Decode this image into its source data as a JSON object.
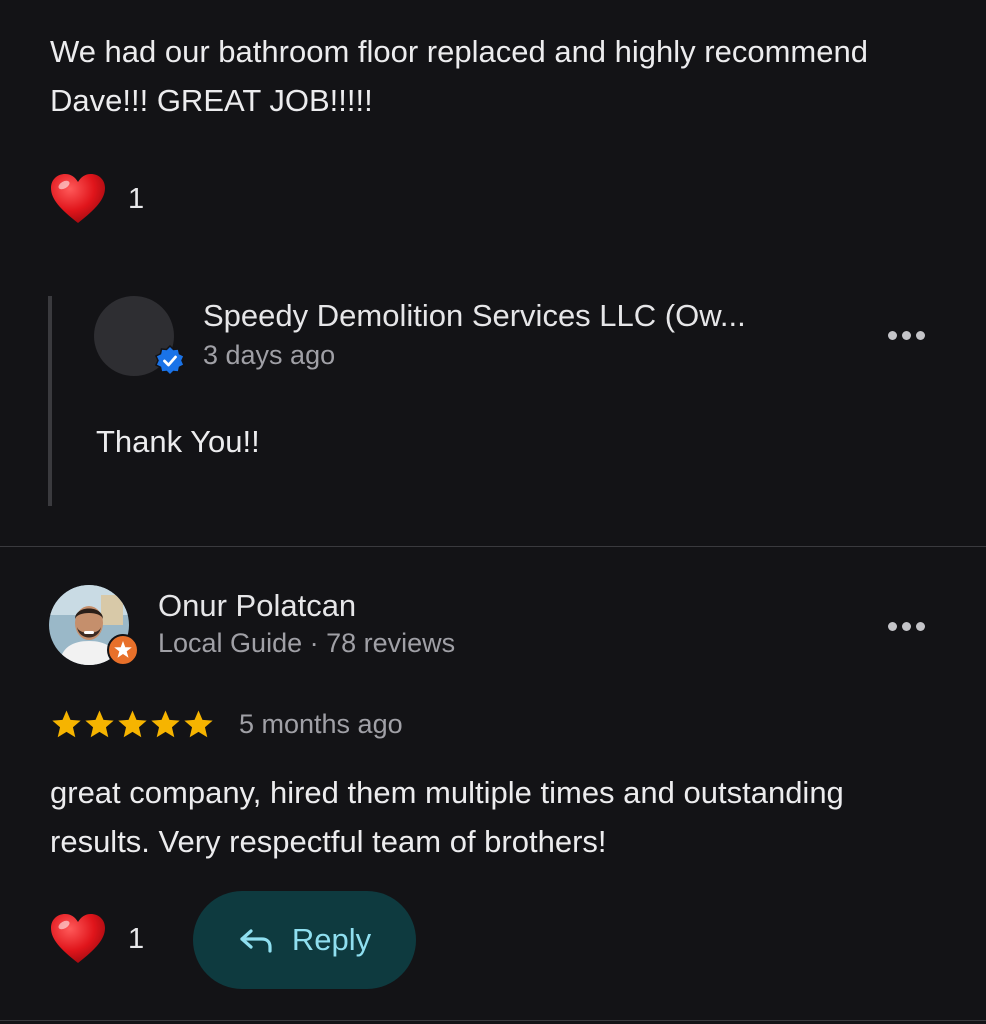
{
  "first_review": {
    "text": "We had our bathroom floor replaced and highly recommend Dave!!!  GREAT JOB!!!!!",
    "reaction_icon": "heart-icon",
    "reaction_count": "1"
  },
  "owner_reply": {
    "name": "Speedy Demolition Services LLC (Ow...",
    "time": "3 days ago",
    "text": "Thank You!!",
    "verified_icon": "verified-badge-icon",
    "more_icon": "more-options-icon"
  },
  "second_review": {
    "author": "Onur Polatcan",
    "meta": "Local Guide · 78 reviews",
    "rating": 5,
    "time": "5 months ago",
    "text": "great company, hired them multiple times and outstanding results. Very respectful team of brothers!",
    "reaction_count": "1",
    "reply_label": "Reply"
  },
  "colors": {
    "background": "#131316",
    "star": "#f6b400",
    "heart": "#e0151b",
    "reply_button_bg": "#0e3a3f",
    "reply_text": "#8fdff0",
    "verified": "#1a73e8",
    "guide_badge": "#e8702a"
  }
}
